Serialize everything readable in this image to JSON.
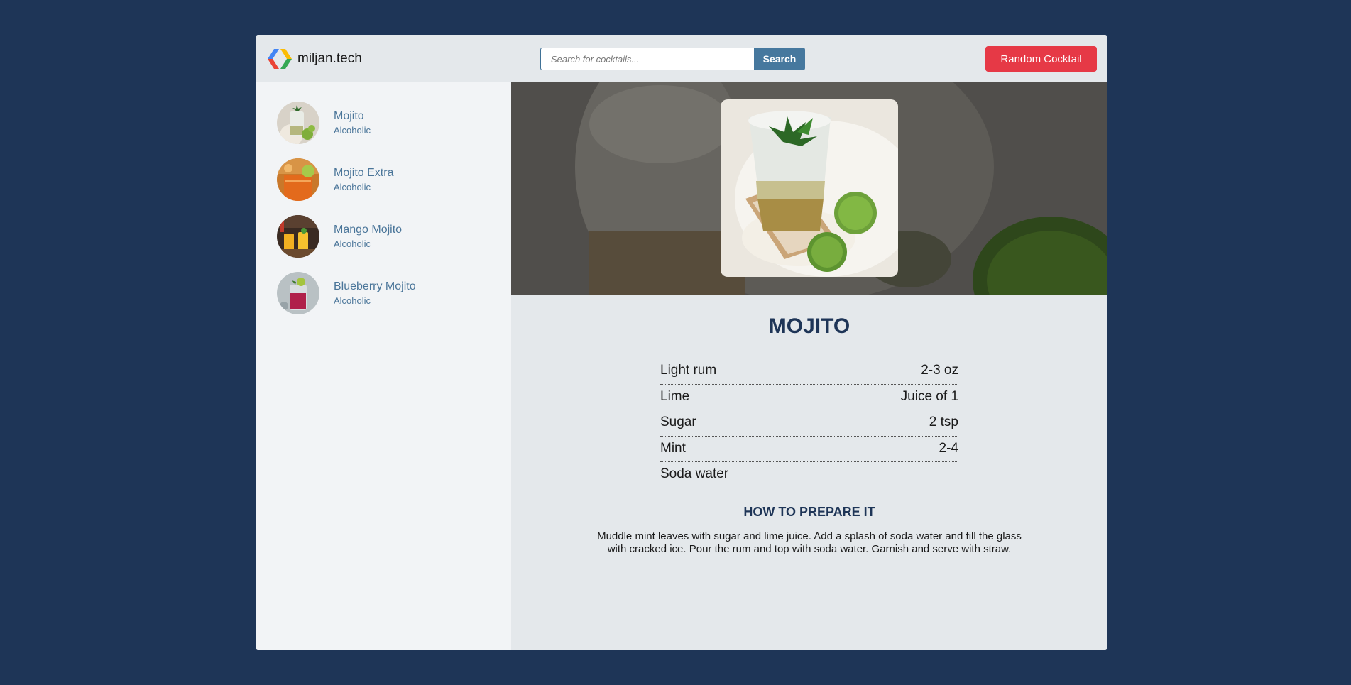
{
  "header": {
    "brand": "miljan.tech",
    "search_placeholder": "Search for cocktails...",
    "search_button": "Search",
    "random_button": "Random Cocktail"
  },
  "sidebar": {
    "items": [
      {
        "name": "Mojito",
        "category": "Alcoholic"
      },
      {
        "name": "Mojito Extra",
        "category": "Alcoholic"
      },
      {
        "name": "Mango Mojito",
        "category": "Alcoholic"
      },
      {
        "name": "Blueberry Mojito",
        "category": "Alcoholic"
      }
    ]
  },
  "drink": {
    "title": "MOJITO",
    "ingredients": [
      {
        "name": "Light rum",
        "measure": "2-3 oz"
      },
      {
        "name": "Lime",
        "measure": "Juice of 1"
      },
      {
        "name": "Sugar",
        "measure": "2 tsp"
      },
      {
        "name": "Mint",
        "measure": "2-4"
      },
      {
        "name": "Soda water",
        "measure": ""
      }
    ],
    "prep_heading": "HOW TO PREPARE IT",
    "instructions": "Muddle mint leaves with sugar and lime juice. Add a splash of soda water and fill the glass with cracked ice. Pour the rum and top with soda water. Garnish and serve with straw."
  },
  "colors": {
    "page_background": "#1e3557",
    "accent": "#46789e",
    "random_button": "#e63946",
    "title": "#1e3557"
  }
}
